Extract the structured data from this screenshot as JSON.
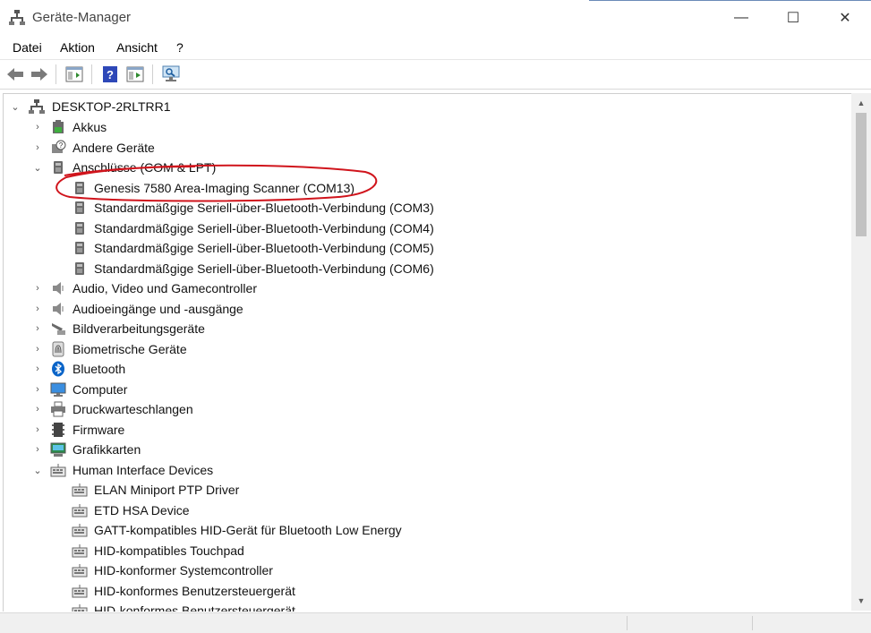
{
  "window": {
    "title": "Geräte-Manager",
    "controls": {
      "minimize": "—",
      "maximize": "☐",
      "close": "✕"
    }
  },
  "menu": [
    "Datei",
    "Aktion",
    "Ansicht",
    "?"
  ],
  "toolbar": [
    "back-arrow-icon",
    "forward-arrow-icon",
    "properties-icon",
    "help-icon",
    "update-driver-icon",
    "scan-hardware-icon"
  ],
  "tree": {
    "root": "DESKTOP-2RLTRR1",
    "nodes": [
      {
        "label": "Akkus",
        "icon": "battery-icon",
        "expanded": false
      },
      {
        "label": "Andere Geräte",
        "icon": "unknown-device-icon",
        "expanded": false
      },
      {
        "label": "Anschlüsse (COM & LPT)",
        "icon": "port-icon",
        "expanded": true,
        "children": [
          "Genesis 7580 Area-Imaging Scanner (COM13)",
          "Standardmäßgige Seriell-über-Bluetooth-Verbindung (COM3)",
          "Standardmäßgige Seriell-über-Bluetooth-Verbindung (COM4)",
          "Standardmäßgige Seriell-über-Bluetooth-Verbindung (COM5)",
          "Standardmäßgige Seriell-über-Bluetooth-Verbindung (COM6)"
        ]
      },
      {
        "label": "Audio, Video und Gamecontroller",
        "icon": "speaker-icon",
        "expanded": false
      },
      {
        "label": "Audioeingänge und -ausgänge",
        "icon": "speaker-icon",
        "expanded": false
      },
      {
        "label": "Bildverarbeitungsgeräte",
        "icon": "camera-icon",
        "expanded": false
      },
      {
        "label": "Biometrische Geräte",
        "icon": "fingerprint-icon",
        "expanded": false
      },
      {
        "label": "Bluetooth",
        "icon": "bluetooth-icon",
        "expanded": false
      },
      {
        "label": "Computer",
        "icon": "monitor-icon",
        "expanded": false
      },
      {
        "label": "Druckwarteschlangen",
        "icon": "printer-icon",
        "expanded": false
      },
      {
        "label": "Firmware",
        "icon": "chip-icon",
        "expanded": false
      },
      {
        "label": "Grafikkarten",
        "icon": "display-adapter-icon",
        "expanded": false
      },
      {
        "label": "Human Interface Devices",
        "icon": "hid-icon",
        "expanded": true,
        "children": [
          "ELAN Miniport PTP Driver",
          "ETD HSA Device",
          "GATT-kompatibles HID-Gerät für Bluetooth Low Energy",
          "HID-kompatibles Touchpad",
          "HID-konformer Systemcontroller",
          "HID-konformes Benutzersteuergerät",
          "HID-konformes Benutzersteuergerät"
        ]
      }
    ]
  },
  "scroll": {
    "position_fraction": 0.0,
    "visible_fraction": 0.24
  },
  "colors": {
    "annotation": "#d0141c",
    "accent": "#0a64c8"
  }
}
